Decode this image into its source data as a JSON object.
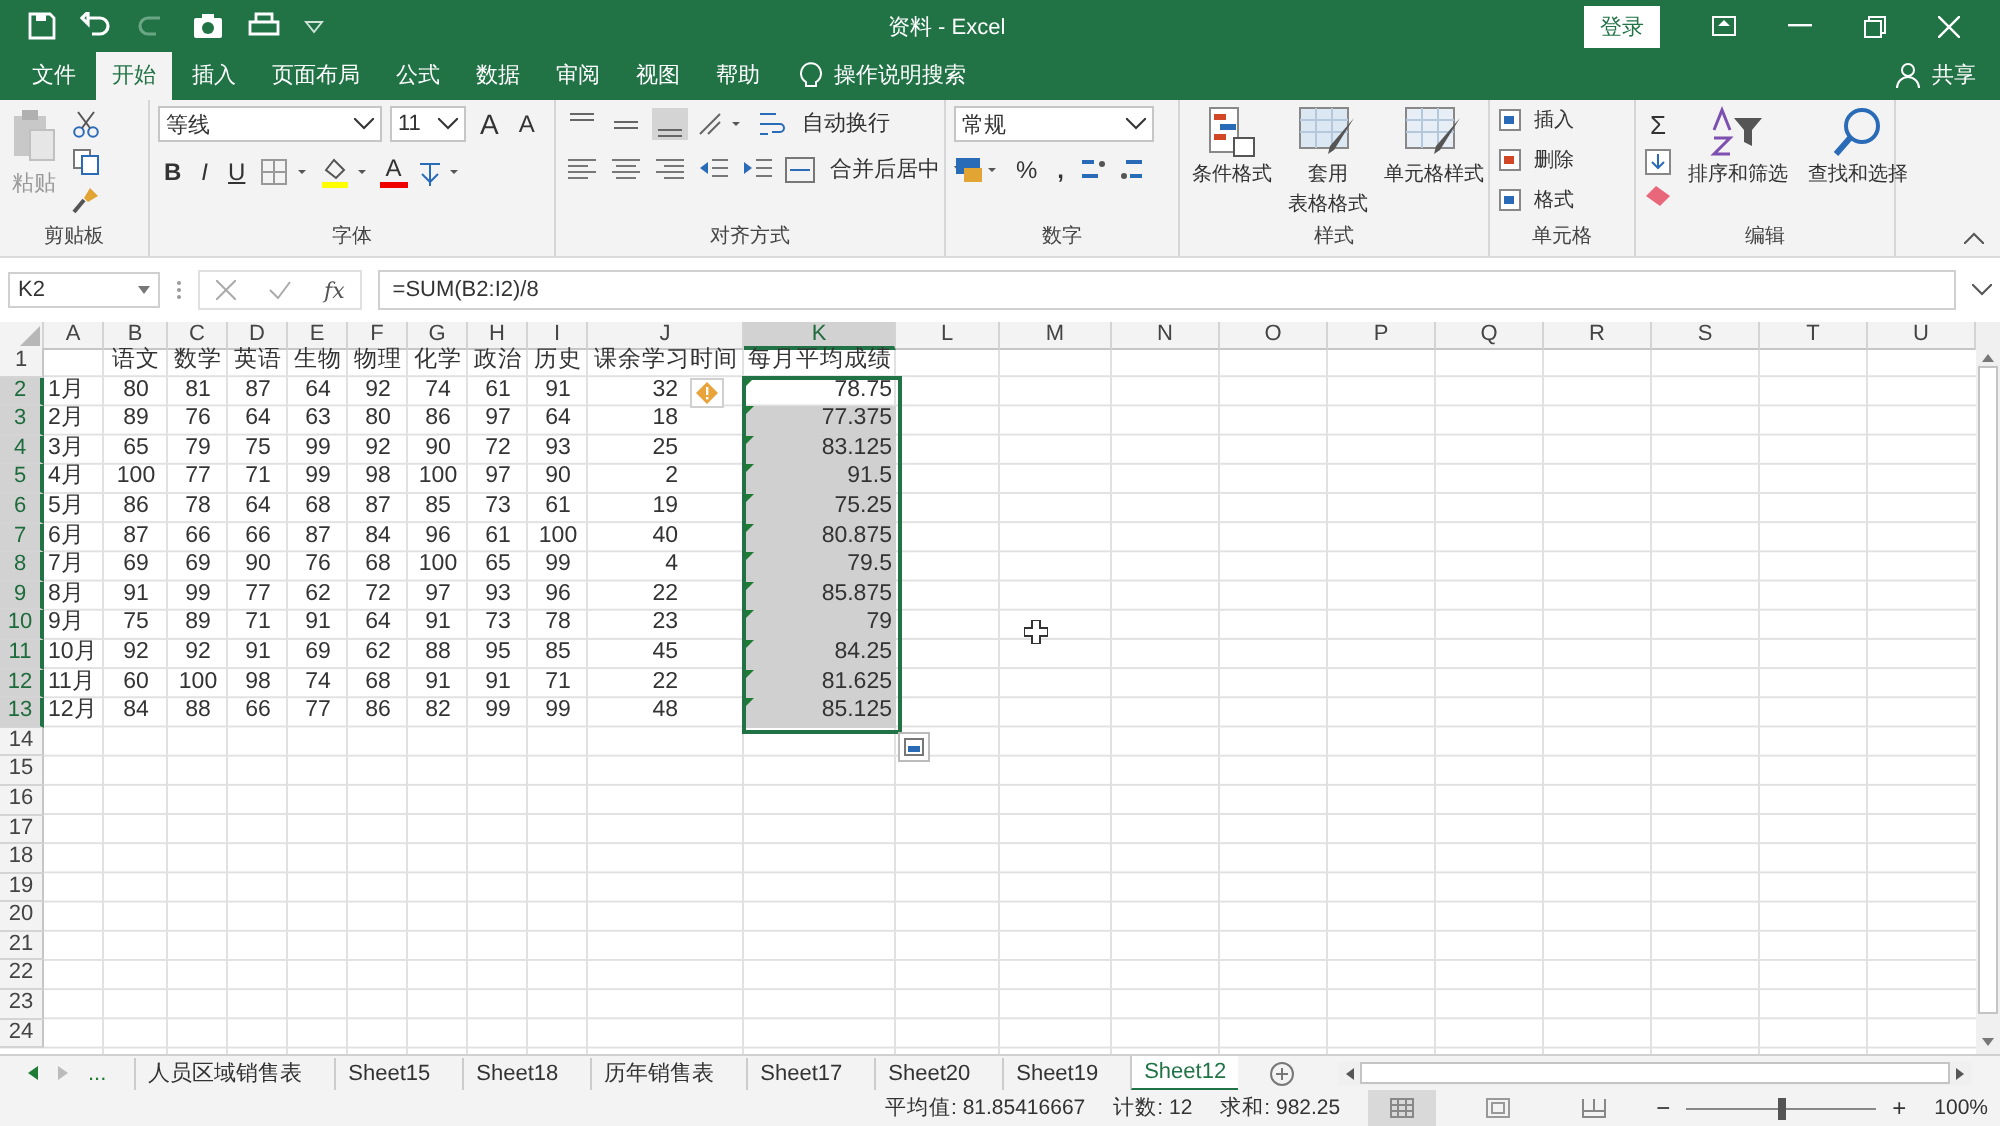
{
  "window": {
    "title": "资料  -  Excel",
    "login": "登录"
  },
  "tabs": [
    {
      "label": "文件",
      "selected": false
    },
    {
      "label": "开始",
      "selected": true
    },
    {
      "label": "插入",
      "selected": false
    },
    {
      "label": "页面布局",
      "selected": false
    },
    {
      "label": "公式",
      "selected": false
    },
    {
      "label": "数据",
      "selected": false
    },
    {
      "label": "审阅",
      "selected": false
    },
    {
      "label": "视图",
      "selected": false
    },
    {
      "label": "帮助",
      "selected": false
    }
  ],
  "tell_me": "操作说明搜索",
  "share": "共享",
  "ribbon": {
    "clipboard": {
      "label": "剪贴板",
      "paste": "粘贴"
    },
    "font": {
      "label": "字体",
      "font_name": "等线",
      "font_size": "11",
      "grow": "A",
      "shrink": "A",
      "styles": [
        "B",
        "I",
        "U"
      ],
      "color_letter": "A"
    },
    "alignment": {
      "label": "对齐方式",
      "wrap": "自动换行",
      "merge": "合并后居中"
    },
    "number": {
      "label": "数字",
      "format": "常规",
      "percent": "%",
      "comma": ","
    },
    "styles": {
      "label": "样式",
      "buttons": [
        {
          "lines": [
            "条件格式"
          ]
        },
        {
          "lines": [
            "套用",
            "表格格式"
          ]
        },
        {
          "lines": [
            "单元格样式"
          ]
        }
      ]
    },
    "cells": {
      "label": "单元格",
      "buttons": [
        "插入",
        "删除",
        "格式"
      ]
    },
    "editing": {
      "label": "编辑",
      "sum": "Σ",
      "sort": "排序和筛选",
      "find": "查找和选择"
    }
  },
  "formula_bar": {
    "name_box": "K2",
    "fx": "fx",
    "formula": "=SUM(B2:I2)/8"
  },
  "columns": [
    {
      "letter": "A",
      "selected": false
    },
    {
      "letter": "B",
      "selected": false
    },
    {
      "letter": "C",
      "selected": false
    },
    {
      "letter": "D",
      "selected": false
    },
    {
      "letter": "E",
      "selected": false
    },
    {
      "letter": "F",
      "selected": false
    },
    {
      "letter": "G",
      "selected": false
    },
    {
      "letter": "H",
      "selected": false
    },
    {
      "letter": "I",
      "selected": false
    },
    {
      "letter": "J",
      "selected": false
    },
    {
      "letter": "K",
      "selected": true
    },
    {
      "letter": "L",
      "selected": false
    },
    {
      "letter": "M",
      "selected": false
    },
    {
      "letter": "N",
      "selected": false
    },
    {
      "letter": "O",
      "selected": false
    },
    {
      "letter": "P",
      "selected": false
    },
    {
      "letter": "Q",
      "selected": false
    },
    {
      "letter": "R",
      "selected": false
    },
    {
      "letter": "S",
      "selected": false
    },
    {
      "letter": "T",
      "selected": false
    },
    {
      "letter": "U",
      "selected": false
    }
  ],
  "heading_row": {
    "number": "1",
    "headings": [
      "语文",
      "数学",
      "英语",
      "生物",
      "物理",
      "化学",
      "政治",
      "历史",
      "课余学习时间",
      "每月平均成绩"
    ]
  },
  "rows": [
    {
      "number": "2",
      "month": "1月",
      "scores": [
        "80",
        "81",
        "87",
        "64",
        "92",
        "74",
        "61",
        "91"
      ],
      "study_time": "32",
      "average": "78.75",
      "selected": true,
      "active": true
    },
    {
      "number": "3",
      "month": "2月",
      "scores": [
        "89",
        "76",
        "64",
        "63",
        "80",
        "86",
        "97",
        "64"
      ],
      "study_time": "18",
      "average": "77.375",
      "selected": true,
      "active": false
    },
    {
      "number": "4",
      "month": "3月",
      "scores": [
        "65",
        "79",
        "75",
        "99",
        "92",
        "90",
        "72",
        "93"
      ],
      "study_time": "25",
      "average": "83.125",
      "selected": true,
      "active": false
    },
    {
      "number": "5",
      "month": "4月",
      "scores": [
        "100",
        "77",
        "71",
        "99",
        "98",
        "100",
        "97",
        "90"
      ],
      "study_time": "2",
      "average": "91.5",
      "selected": true,
      "active": false
    },
    {
      "number": "6",
      "month": "5月",
      "scores": [
        "86",
        "78",
        "64",
        "68",
        "87",
        "85",
        "73",
        "61"
      ],
      "study_time": "19",
      "average": "75.25",
      "selected": true,
      "active": false
    },
    {
      "number": "7",
      "month": "6月",
      "scores": [
        "87",
        "66",
        "66",
        "87",
        "84",
        "96",
        "61",
        "100"
      ],
      "study_time": "40",
      "average": "80.875",
      "selected": true,
      "active": false
    },
    {
      "number": "8",
      "month": "7月",
      "scores": [
        "69",
        "69",
        "90",
        "76",
        "68",
        "100",
        "65",
        "99"
      ],
      "study_time": "4",
      "average": "79.5",
      "selected": true,
      "active": false
    },
    {
      "number": "9",
      "month": "8月",
      "scores": [
        "91",
        "99",
        "77",
        "62",
        "72",
        "97",
        "93",
        "96"
      ],
      "study_time": "22",
      "average": "85.875",
      "selected": true,
      "active": false
    },
    {
      "number": "10",
      "month": "9月",
      "scores": [
        "75",
        "89",
        "71",
        "91",
        "64",
        "91",
        "73",
        "78"
      ],
      "study_time": "23",
      "average": "79",
      "selected": true,
      "active": false
    },
    {
      "number": "11",
      "month": "10月",
      "scores": [
        "92",
        "92",
        "91",
        "69",
        "62",
        "88",
        "95",
        "85"
      ],
      "study_time": "45",
      "average": "84.25",
      "selected": true,
      "active": false
    },
    {
      "number": "12",
      "month": "11月",
      "scores": [
        "60",
        "100",
        "98",
        "74",
        "68",
        "91",
        "91",
        "71"
      ],
      "study_time": "22",
      "average": "81.625",
      "selected": true,
      "active": false
    },
    {
      "number": "13",
      "month": "12月",
      "scores": [
        "84",
        "88",
        "66",
        "77",
        "86",
        "82",
        "99",
        "99"
      ],
      "study_time": "48",
      "average": "85.125",
      "selected": true,
      "active": false
    }
  ],
  "empty_rows": [
    "14",
    "15",
    "16",
    "17",
    "18",
    "19",
    "20",
    "21",
    "22",
    "23",
    "24"
  ],
  "sheet_tabs": {
    "more": "...",
    "tabs": [
      {
        "label": "人员区域销售表",
        "selected": false
      },
      {
        "label": "Sheet15",
        "selected": false
      },
      {
        "label": "Sheet18",
        "selected": false
      },
      {
        "label": "历年销售表",
        "selected": false
      },
      {
        "label": "Sheet17",
        "selected": false
      },
      {
        "label": "Sheet20",
        "selected": false
      },
      {
        "label": "Sheet19",
        "selected": false
      },
      {
        "label": "Sheet12",
        "selected": true
      }
    ]
  },
  "status_bar": {
    "average": "平均值: 81.85416667",
    "count": "计数: 12",
    "sum": "求和: 982.25",
    "views": [
      {
        "kind": "normal",
        "selected": true
      },
      {
        "kind": "layout",
        "selected": false
      },
      {
        "kind": "break",
        "selected": false
      }
    ],
    "zoom_out": "−",
    "zoom_in": "+",
    "zoom": {
      "level": 0.5
    },
    "zoom_text": "100%"
  }
}
